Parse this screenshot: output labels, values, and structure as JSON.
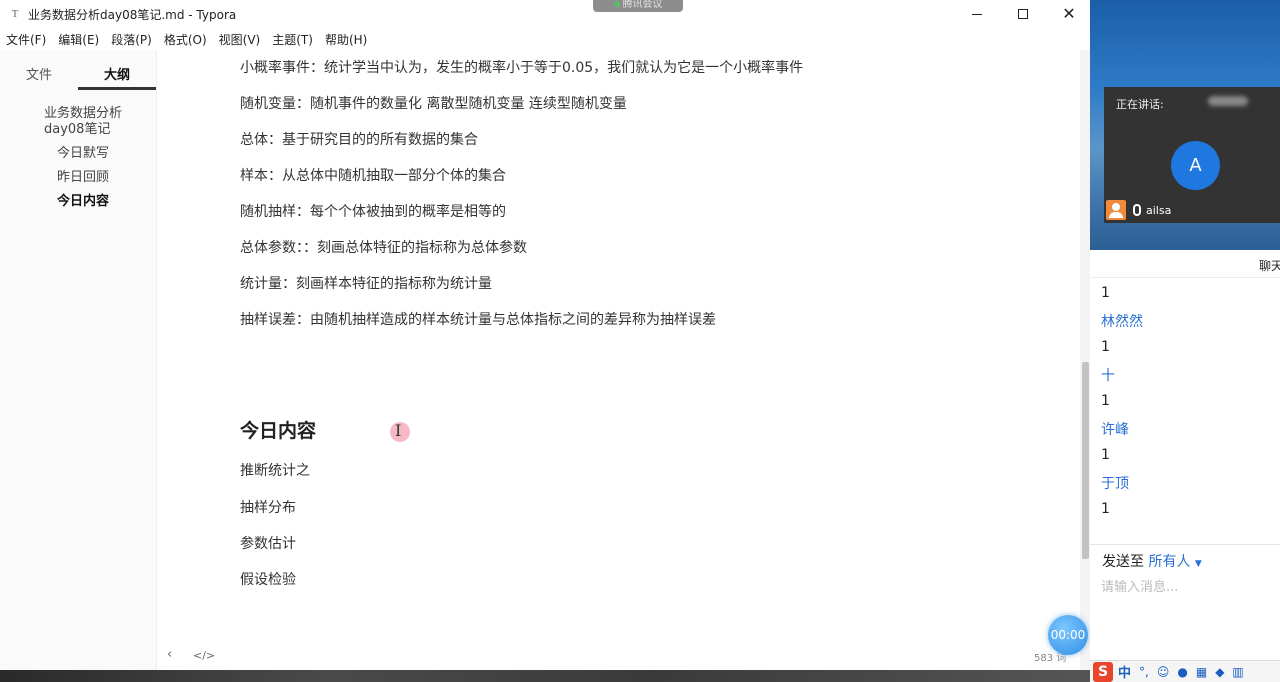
{
  "window": {
    "title": "业务数据分析day08笔记.md - Typora",
    "app_icon": "T",
    "meeting_badge": "腾讯会议"
  },
  "menu": [
    "文件(F)",
    "编辑(E)",
    "段落(P)",
    "格式(O)",
    "视图(V)",
    "主题(T)",
    "帮助(H)"
  ],
  "sidebar": {
    "tab_files": "文件",
    "tab_outline": "大纲",
    "outline": [
      {
        "label": "业务数据分析",
        "level": 1
      },
      {
        "label": "day08笔记",
        "level": 1
      },
      {
        "label": "今日默写",
        "level": 2
      },
      {
        "label": "昨日回顾",
        "level": 2
      },
      {
        "label": "今日内容",
        "level": 2,
        "active": true
      }
    ],
    "footer_prev": "‹",
    "footer_source": "</>"
  },
  "editor": {
    "paragraphs": [
      "小概率事件：统计学当中认为，发生的概率小于等于0.05，我们就认为它是一个小概率事件",
      "随机变量：随机事件的数量化 离散型随机变量 连续型随机变量",
      "总体：基于研究目的的所有数据的集合",
      "样本：从总体中随机抽取一部分个体的集合",
      "随机抽样：每个个体被抽到的概率是相等的",
      "总体参数：：刻画总体特征的指标称为总体参数",
      "统计量：刻画样本特征的指标称为统计量",
      "抽样误差：由随机抽样造成的样本统计量与总体指标之间的差异称为抽样误差"
    ],
    "heading": "今日内容",
    "list_items": [
      "推断统计之",
      "抽样分布",
      "参数估计",
      "假设检验"
    ],
    "word_count": "583 词",
    "timer": "00:00"
  },
  "meeting": {
    "speaking_label": "正在讲话:",
    "avatar_letter": "A",
    "user_name": "ailsa",
    "chat_title": "聊天",
    "chat_messages": [
      {
        "type": "msg",
        "text": "1"
      },
      {
        "type": "sender",
        "text": "林然然"
      },
      {
        "type": "msg",
        "text": "1"
      },
      {
        "type": "sender",
        "text": "十"
      },
      {
        "type": "msg",
        "text": "1"
      },
      {
        "type": "sender",
        "text": "许峰"
      },
      {
        "type": "msg",
        "text": "1"
      },
      {
        "type": "sender",
        "text": "于顶"
      },
      {
        "type": "msg",
        "text": "1"
      }
    ],
    "send_to_label": "发送至",
    "send_to_target": "所有人",
    "input_placeholder": "请输入消息..."
  },
  "ime": {
    "logo": "S",
    "mode": "中",
    "punct": "°,"
  },
  "colors": {
    "accent_blue": "#2b6fd6",
    "avatar_blue": "#1e78e0",
    "ime_red": "#e8452c"
  }
}
